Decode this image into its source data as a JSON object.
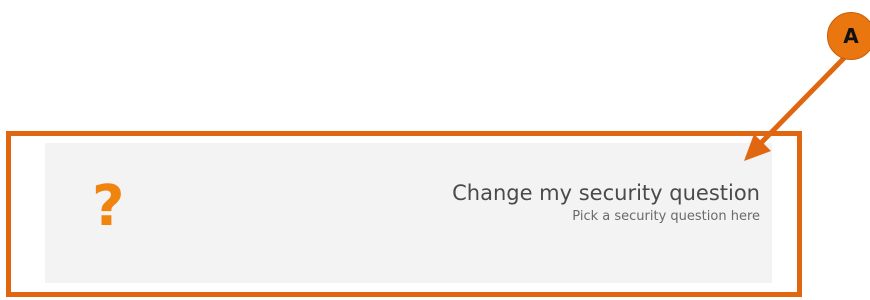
{
  "settings_item": {
    "icon": "question-mark-icon",
    "icon_glyph": "?",
    "title": "Change my security question",
    "subtitle": "Pick a security question here"
  },
  "annotation": {
    "badge_label": "A",
    "color": "#e0660f"
  },
  "colors": {
    "accent": "#f0840e",
    "card_background": "#f4f3f3",
    "title_text": "#4a4a4a"
  }
}
